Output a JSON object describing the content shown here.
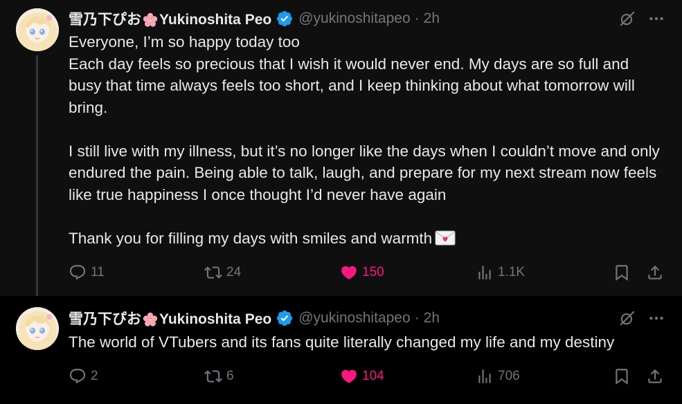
{
  "colors": {
    "background": "#000000",
    "highlight_background": "#0f0f0f",
    "text": "#e7e9ea",
    "secondary": "#71767b",
    "like_pink": "#f91880",
    "verified_blue": "#1d9bf0"
  },
  "tweets": [
    {
      "display_name_jp": "雪乃下ぴお",
      "display_name_en": "Yukinoshita Peo",
      "handle": "@yukinoshitapeo",
      "separator": "·",
      "time": "2h",
      "text": "Everyone, I’m so happy today too\nEach day feels so precious that I wish it would never end. My days are so full and busy that time always feels too short, and I keep thinking about what tomorrow will bring.\n\nI still live with my illness, but it’s no longer like the days when I couldn’t move and only endured the pain. Being able to talk, laugh, and prepare for my next stream now feels like true happiness I once thought I’d never have again\n\nThank you for filling my days with smiles and warmth",
      "reply_count": "11",
      "retweet_count": "24",
      "like_count": "150",
      "view_count": "1.1K",
      "liked": true
    },
    {
      "display_name_jp": "雪乃下ぴお",
      "display_name_en": "Yukinoshita Peo",
      "handle": "@yukinoshitapeo",
      "separator": "·",
      "time": "2h",
      "text": "The world of VTubers and its fans quite literally changed my life and my destiny",
      "reply_count": "2",
      "retweet_count": "6",
      "like_count": "104",
      "view_count": "706",
      "liked": true
    }
  ],
  "icons": [
    "avatar",
    "cherry-blossom-icon",
    "verified-badge-icon",
    "grok-icon",
    "more-icon",
    "reply-icon",
    "retweet-icon",
    "like-icon",
    "views-icon",
    "bookmark-icon",
    "share-icon",
    "love-letter-icon"
  ]
}
